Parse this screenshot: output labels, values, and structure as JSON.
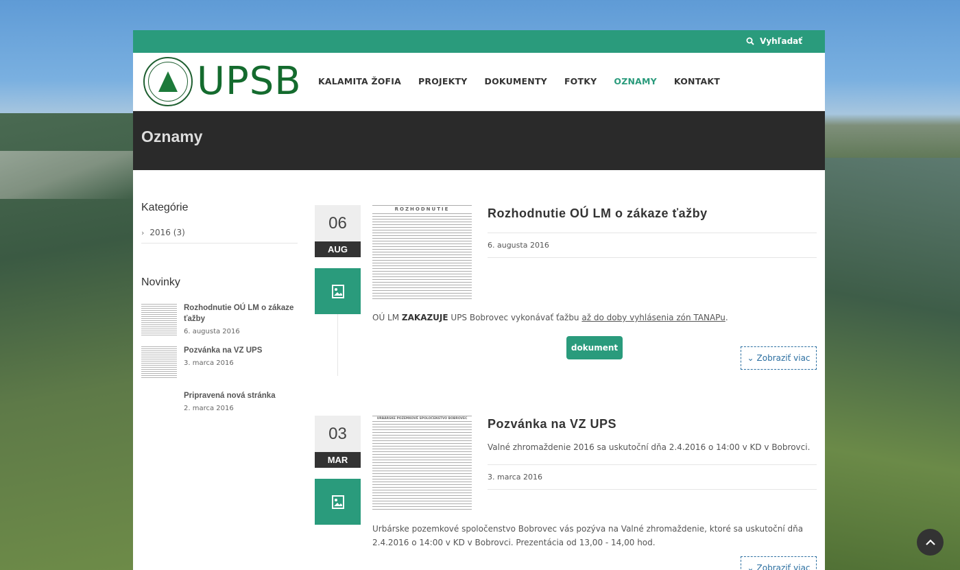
{
  "topbar": {
    "search_label": "Vyhľadať"
  },
  "logo": {
    "text": "UPSB"
  },
  "nav": [
    {
      "label": "KALAMITA ŽOFIA",
      "active": false
    },
    {
      "label": "PROJEKTY",
      "active": false
    },
    {
      "label": "DOKUMENTY",
      "active": false
    },
    {
      "label": "FOTKY",
      "active": false
    },
    {
      "label": "OZNAMY",
      "active": true
    },
    {
      "label": "KONTAKT",
      "active": false
    }
  ],
  "page": {
    "title": "Oznamy"
  },
  "sidebar": {
    "categories_heading": "Kategórie",
    "category": "2016 (3)",
    "news_heading": "Novinky",
    "news": [
      {
        "title": "Rozhodnutie OÚ LM o zákaze ťažby",
        "date": "6. augusta 2016"
      },
      {
        "title": "Pozvánka na VZ UPS",
        "date": "3. marca 2016"
      },
      {
        "title": "Pripravená nová stránka",
        "date": "2. marca 2016"
      }
    ]
  },
  "posts": [
    {
      "day": "06",
      "month": "AUG",
      "title": "Rozhodnutie OÚ LM o zákaze ťažby",
      "date": "6. augusta 2016",
      "image_heading": "ROZHODNUTIE",
      "body_pre": "OÚ LM ",
      "body_bold": "ZAKAZUJE",
      "body_mid": " UPS Bobrovec vykonávať ťažbu ",
      "body_link": "až do doby vyhlásenia zón TANAPu",
      "body_post": ".",
      "doc_button": "dokument",
      "more_button": "Zobraziť viac"
    },
    {
      "day": "03",
      "month": "MAR",
      "title": "Pozvánka na VZ UPS",
      "lead": "Valné zhromaždenie 2016 sa uskutoční dňa 2.4.2016 o 14:00 v KD v Bobrovci.",
      "date": "3. marca 2016",
      "image_heading": "URBÁRSKE POZEMKOVÉ SPOLOČENSTVO BOBROVEC",
      "body": "Urbárske pozemkové spoločenstvo Bobrovec vás pozýva na Valné zhromaždenie, ktoré sa uskutoční dňa 2.4.2016 o 14:00 v KD v Bobrovci. Prezentácia od 13,00 - 14,00 hod.",
      "more_button": "Zobraziť viac"
    }
  ],
  "colors": {
    "accent": "#2a9b7c",
    "dark": "#2a2a2a"
  }
}
